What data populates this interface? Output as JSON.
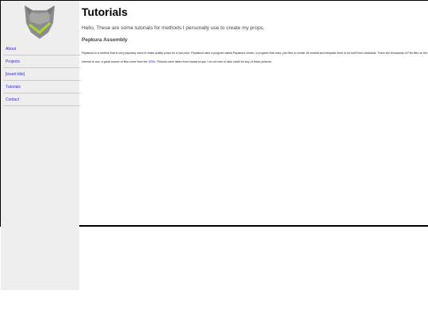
{
  "sidebar": {
    "logo": "masked-helmet-logo",
    "items": [
      {
        "label": "About"
      },
      {
        "label": "Projects"
      },
      {
        "label": "[insert title]"
      },
      {
        "label": "Tutorials"
      },
      {
        "label": "Contact"
      }
    ]
  },
  "main": {
    "title": "Tutorials",
    "intro": "Hello, These are some tutorials for methods I personally use to create my props.",
    "subhead": "Pepkura Assembly",
    "body_before_link": "Pepakura is a method that is very popularly used to make quality props for a low price. Pepakura uses a program called Pepakura viewer, a program that uses .pdo files to create 3d models and template them to be built from cardstock. There are thousands of Pdo files on the internet to use, a great source of files come from the ",
    "body_link": "405th",
    "body_after_link": ". Pictures were taken from impact props, I do not own or take credit for any of these pictures."
  },
  "colors": {
    "link": "#2b2bd6",
    "sidebar_bg": "#eeeeee",
    "logo_gray": "#8c8c8c",
    "logo_green": "#a8d23a"
  }
}
